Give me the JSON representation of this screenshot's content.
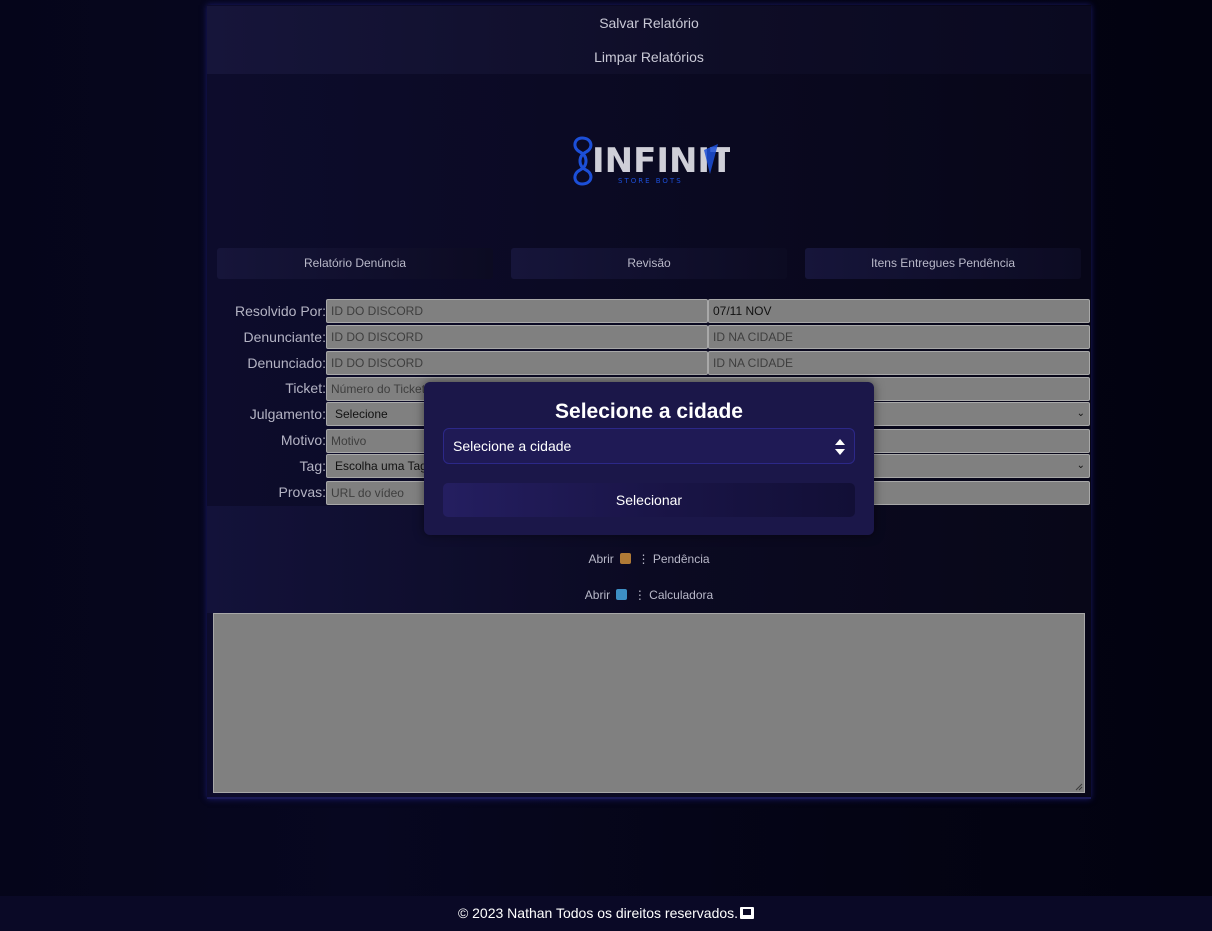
{
  "header": {
    "save_label": "Salvar Relatório",
    "clear_label": "Limpar Relatórios"
  },
  "logo": {
    "brand": "INFINITY",
    "sub": "STORE BOTS"
  },
  "tabs": [
    {
      "label": "Relatório Denúncia"
    },
    {
      "label": "Revisão"
    },
    {
      "label": "Itens Entregues Pendência"
    }
  ],
  "form": {
    "resolvido_label": "Resolvido Por:",
    "resolvido_placeholder": "ID DO DISCORD",
    "date_value": "07/11 NOV",
    "denunciante_label": "Denunciante:",
    "denunciante_discord_placeholder": "ID DO DISCORD",
    "denunciante_city_placeholder": "ID NA CIDADE",
    "denunciado_label": "Denunciado:",
    "denunciado_discord_placeholder": "ID DO DISCORD",
    "denunciado_city_placeholder": "ID NA CIDADE",
    "ticket_label": "Ticket:",
    "ticket_placeholder": "Número do Ticket",
    "julgamento_label": "Julgamento:",
    "julgamento_value": "Selecione",
    "motivo_label": "Motivo:",
    "motivo_placeholder": "Motivo",
    "tag_label": "Tag:",
    "tag_value": "Escolha uma Tag",
    "provas_label": "Provas:",
    "provas_placeholder": "URL do vídeo"
  },
  "actions": {
    "open_label": "Abrir",
    "separator": "⋮",
    "pendencia_label": "Pendência",
    "calculadora_label": "Calculadora"
  },
  "modal": {
    "title": "Selecione a cidade",
    "select_value": "Selecione a cidade",
    "button_label": "Selecionar"
  },
  "footer": {
    "text": "© 2023 Nathan Todos os direitos reservados."
  },
  "colors": {
    "background": "#05051a",
    "modal": "#1b1749",
    "field": "#808080",
    "logo_blue": "#1c4fd8"
  },
  "icons": {
    "pendencia": "package-icon",
    "calculadora": "abacus-icon",
    "footer": "laptop-icon"
  }
}
